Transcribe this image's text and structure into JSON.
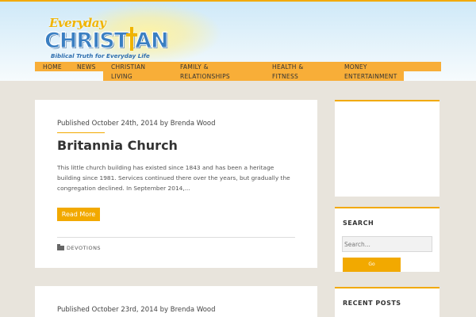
{
  "logo": {
    "line1": "Everyday",
    "line2": "CHRISTIAN",
    "tagline": "Biblical Truth for Everyday Life"
  },
  "nav": {
    "items": [
      {
        "label": "HOME"
      },
      {
        "label": "NEWS"
      },
      {
        "label_line1": "CHRISTIAN",
        "label_line2": "LIVING"
      },
      {
        "label_line1": "FAMILY &",
        "label_line2": "RELATIONSHIPS"
      },
      {
        "label_line1": "HEALTH &",
        "label_line2": "FITNESS"
      },
      {
        "label_line1": "MONEY",
        "label_line2": "ENTERTAINMENT"
      }
    ],
    "active_color": "#f8ae38"
  },
  "posts": [
    {
      "byline": "Published October 24th, 2014 by Brenda Wood",
      "title": "Britannia Church",
      "excerpt": "This little church building has existed since 1843 and has been a heritage building since 1981. Services continued there over the years, but gradually the congregation declined. In September 2014,...",
      "read_more": "Read More",
      "category": "DEVOTIONS"
    },
    {
      "byline": "Published October 23rd, 2014 by Brenda Wood"
    }
  ],
  "sidebar": {
    "search": {
      "title": "SEARCH",
      "placeholder": "Search...",
      "button": "Go"
    },
    "recent": {
      "title": "RECENT POSTS"
    }
  },
  "colors": {
    "accent": "#f2a900",
    "background": "#e8e4dc",
    "logo_blue": "#3a7fc2"
  }
}
